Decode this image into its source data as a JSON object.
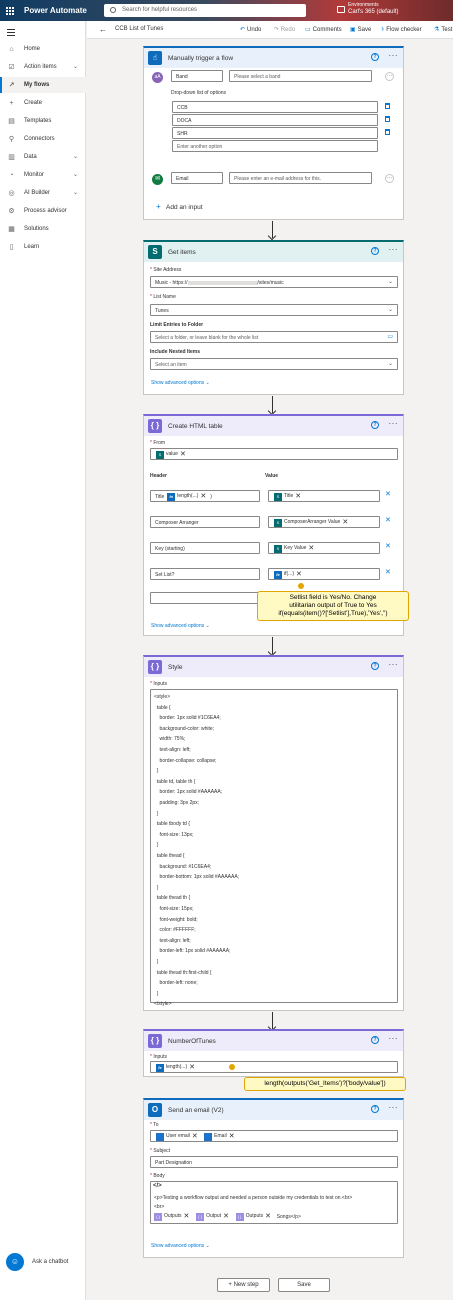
{
  "topbar": {
    "app_name": "Power Automate",
    "search_placeholder": "Search for helpful resources",
    "env_label": "Environments",
    "env_name": "Carl's 365 (default)"
  },
  "sidebar": {
    "items": [
      {
        "label": "Home",
        "icon": "home-icon"
      },
      {
        "label": "Action items",
        "icon": "checklist-icon"
      },
      {
        "label": "My flows",
        "icon": "flow-icon"
      },
      {
        "label": "Create",
        "icon": "plus-icon"
      },
      {
        "label": "Templates",
        "icon": "template-icon"
      },
      {
        "label": "Connectors",
        "icon": "connector-icon"
      },
      {
        "label": "Data",
        "icon": "database-icon"
      },
      {
        "label": "Monitor",
        "icon": "monitor-icon"
      },
      {
        "label": "AI Builder",
        "icon": "ai-icon"
      },
      {
        "label": "Process advisor",
        "icon": "process-icon"
      },
      {
        "label": "Solutions",
        "icon": "solutions-icon"
      },
      {
        "label": "Learn",
        "icon": "book-icon"
      }
    ],
    "chatbot_label": "Ask a chatbot"
  },
  "cmdbar": {
    "flow_title": "CCB List of Tunes",
    "undo": "Undo",
    "redo": "Redo",
    "comments": "Comments",
    "save": "Save",
    "flow_checker": "Flow checker",
    "test": "Test"
  },
  "trigger": {
    "title": "Manually trigger a flow",
    "band_label": "Band",
    "band_placeholder": "Please select a band",
    "dropdown_label": "Drop-down list of options",
    "options": [
      "CCB",
      "DOCA",
      "SHR"
    ],
    "another_option_placeholder": "Enter another option",
    "email_label": "Email",
    "email_placeholder": "Please enter an e-mail address for this.",
    "add_input": "Add an input"
  },
  "get_items": {
    "title": "Get items",
    "site_label": "Site Address",
    "site_value_prefix": "Music - https://",
    "site_value_suffix": "/sites/music",
    "list_label": "List Name",
    "list_value": "Tunes",
    "limit_label": "Limit Entries to Folder",
    "limit_placeholder": "Select a folder, or leave blank for the whole list",
    "nested_label": "Include Nested Items",
    "nested_placeholder": "Select an item",
    "advanced": "Show advanced options"
  },
  "html_table": {
    "title": "Create HTML table",
    "from_label": "From",
    "from_token": "value",
    "header_col": "Header",
    "value_col": "Value",
    "rows": [
      {
        "header": "Title",
        "header_token": "length(...)",
        "header_suffix": ")",
        "value_token": "Title",
        "value_type": "sp"
      },
      {
        "header": "Composer Arranger",
        "value_token": "ComposerArranger Value",
        "value_type": "sp"
      },
      {
        "header": "Key (starting)",
        "value_token": "Key Value",
        "value_type": "sp"
      },
      {
        "header": "Set List?",
        "value_token": "if(...)",
        "value_type": "fx"
      }
    ],
    "advanced": "Show advanced options"
  },
  "callout1": {
    "line1": "Setlist field is Yes/No. Change",
    "line2": "utilitarian output of True to Yes",
    "line3": "if(equals(item()?['Setlist'],True),'Yes','')"
  },
  "style_card": {
    "title": "Style",
    "inputs_label": "Inputs",
    "code": [
      "<style>",
      "  table {",
      "    border: 1px solid #1C6EA4;",
      "    background-color: white;",
      "    width: 75%;",
      "    text-align: left;",
      "    border-collapse: collapse;",
      "  }",
      "  table td, table th {",
      "    border: 1px solid #AAAAAA;",
      "    padding: 3px 2px;",
      "  }",
      "  table tbody td {",
      "    font-size: 13px;",
      "  }",
      "  table thead {",
      "    background: #1C6EA4;",
      "    border-bottom: 1px solid #AAAAAA;",
      "  }",
      "  table thead th {",
      "    font-size: 15px;",
      "    font-weight: bold;",
      "    color: #FFFFFF;",
      "    text-align: left;",
      "    border-left: 1px solid #AAAAAA;",
      "  }",
      "  table thead th:first-child {",
      "    border-left: none;",
      "  }",
      "</style>"
    ]
  },
  "number_card": {
    "title": "NumberOfTunes",
    "inputs_label": "Inputs",
    "token": "length(...)"
  },
  "callout2": {
    "text": "length(outputs('Get_Items')?['body/value'])"
  },
  "email_card": {
    "title": "Send an email (V2)",
    "to_label": "To",
    "to_tokens": [
      "User email",
      "Email"
    ],
    "subject_label": "Subject",
    "subject_value": "Part Designation",
    "body_label": "Body",
    "body_code_icon": "</>",
    "body_line1": "<p>Testing a workflow output and needed a person outside my credentials to test on.<br>",
    "body_line2": "<br>",
    "body_tokens": [
      "Outputs",
      "Output",
      "Outputs"
    ],
    "body_tail": "Songs</p>",
    "advanced": "Show advanced options"
  },
  "footer": {
    "new_step": "+ New step",
    "save": "Save"
  },
  "colors": {
    "accent": "#0078d4",
    "trigger_icon": "#0f6cbd",
    "sharepoint": "#036c70",
    "data_ops": "#7b69d6",
    "outlook": "#0f6cbd"
  }
}
